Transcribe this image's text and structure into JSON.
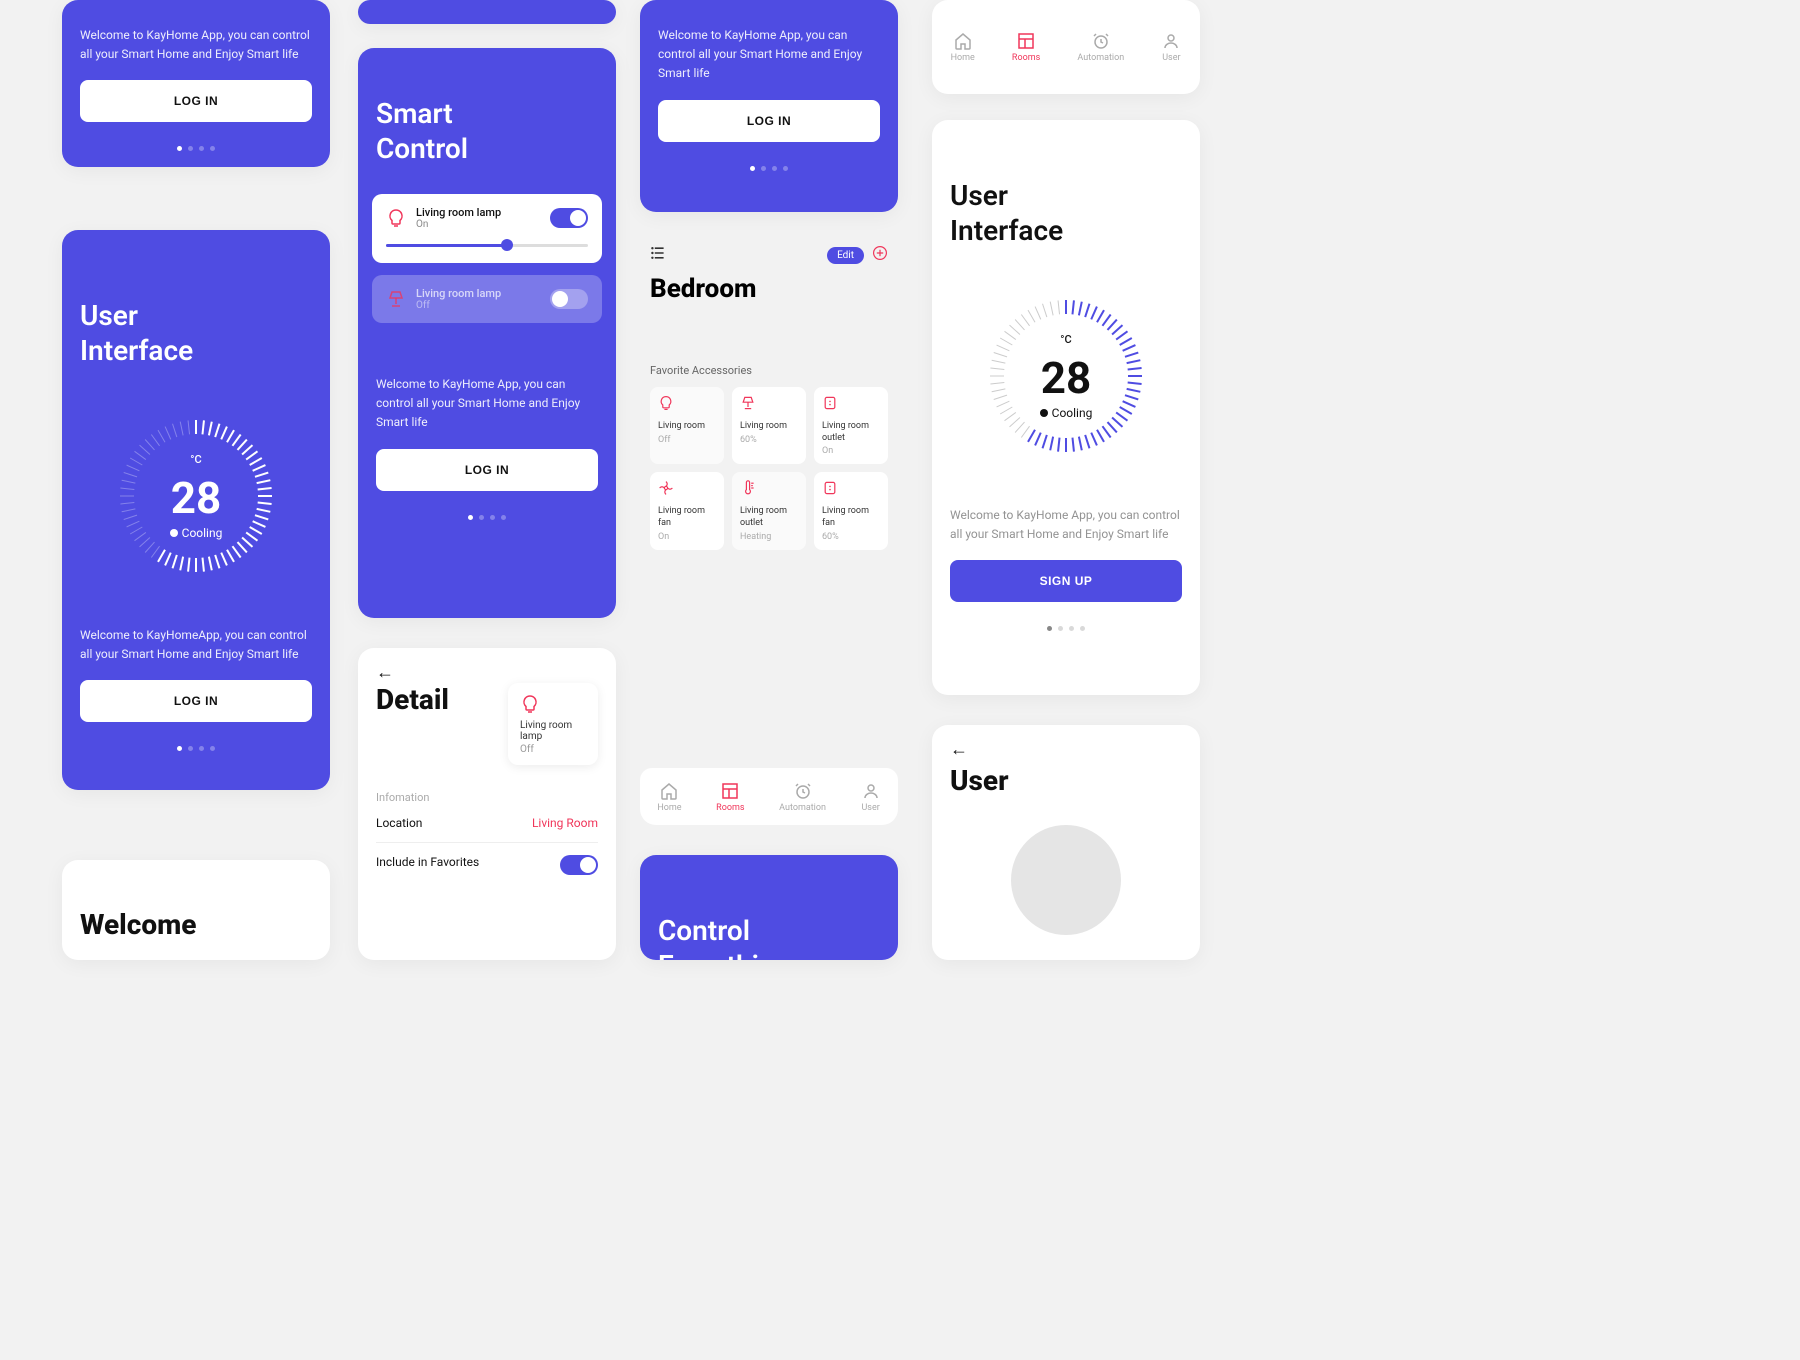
{
  "colors": {
    "accent": "#4f4ce2",
    "danger": "#f0365a"
  },
  "welcome_text": "Welcome to KayHome App, you can control all your Smart Home and Enjoy Smart life",
  "welcome_text_alt": "Welcome to KayHomeApp, you can control all your Smart Home and Enjoy Smart life",
  "login_label": "LOG IN",
  "signup_label": "SIGN UP",
  "ui_title": "User\nInterface",
  "thermo": {
    "unit": "°C",
    "temp": "28",
    "status": "Cooling"
  },
  "smart_control": {
    "title": "Smart\nControl",
    "devices": [
      {
        "name": "Living room lamp",
        "state": "On",
        "icon": "bulb"
      },
      {
        "name": "Living room lamp",
        "state": "Off",
        "icon": "lamp"
      }
    ]
  },
  "detail": {
    "back": "←",
    "title": "Detail",
    "card": {
      "name": "Living room lamp",
      "state": "Off"
    },
    "info_label": "Infomation",
    "location_label": "Location",
    "location_value": "Living Room",
    "fav_label": "Include in Favorites"
  },
  "bedroom": {
    "title": "Bedroom",
    "edit": "Edit",
    "fav_label": "Favorite Accessories",
    "tiles": [
      {
        "name": "Living room",
        "state": "Off",
        "icon": "bulb"
      },
      {
        "name": "Living room",
        "state": "60%",
        "icon": "lamp"
      },
      {
        "name": "Living room outlet",
        "state": "On",
        "icon": "outlet"
      },
      {
        "name": "Living room fan",
        "state": "On",
        "icon": "fan"
      },
      {
        "name": "Living room outlet",
        "state": "Heating",
        "icon": "thermo"
      },
      {
        "name": "Living room fan",
        "state": "60%",
        "icon": "outlet"
      }
    ]
  },
  "nav": {
    "items": [
      {
        "label": "Home",
        "icon": "home"
      },
      {
        "label": "Rooms",
        "icon": "rooms"
      },
      {
        "label": "Automation",
        "icon": "clock"
      },
      {
        "label": "User",
        "icon": "user"
      }
    ],
    "active": 1
  },
  "control_title": "Control\nEverything",
  "welcome_title": "Welcome",
  "user_title": "User"
}
